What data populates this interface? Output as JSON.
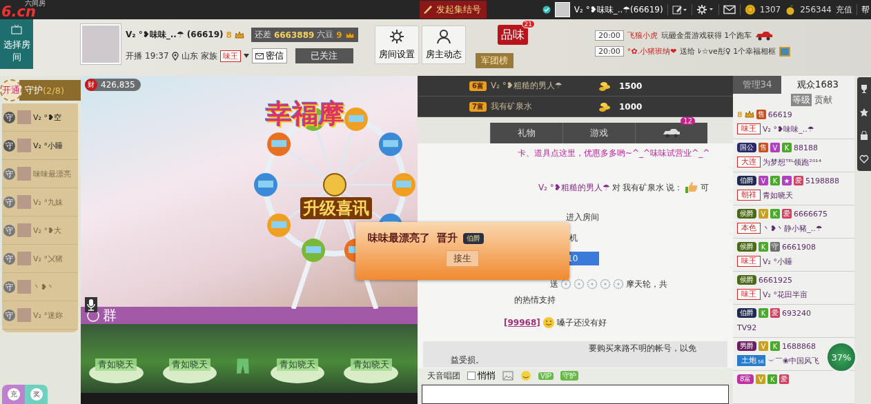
{
  "top_bar": {
    "logo_caption": "六间房",
    "logo": "6.cn",
    "rally_button": "发起集结号",
    "user_name": "V₂ °❥味味_..☂(66619)",
    "coins": "1307",
    "beans": "256344",
    "recharge": "充值",
    "help": "帮"
  },
  "room_button": "选择房间",
  "host": {
    "name": "V₂ °❥味味_..☂ (66619)",
    "level": "8",
    "gap_label": "还差",
    "gap_value": "6663889",
    "gap_unit": "六豆",
    "next_level": "9",
    "live_label": "开播",
    "live_time": "19:37",
    "location": "山东",
    "family_label": "家族",
    "family_tag": "味王",
    "message_button": "密信",
    "follow_button": "已关注"
  },
  "room_actions": [
    {
      "label": "房间设置"
    },
    {
      "label": "房主动态"
    }
  ],
  "taste_seal": {
    "label": "品味",
    "count": "21"
  },
  "legion_tab": "军团榜",
  "announcements": [
    {
      "time": "20:00",
      "user": "飞狼小虎",
      "text": "玩砸金蛋游戏获得 1个跑车",
      "kind": "car"
    },
    {
      "time": "20:00",
      "user": "°✿.小猪班纳❤",
      "text": "送给 ﾚ☆ve彤♀ 1个幸福相框",
      "kind": "frame"
    }
  ],
  "guard": {
    "open_button": "开通",
    "title": "守护",
    "count": "(2/8)",
    "members": [
      {
        "badge": "守",
        "name": "V₂ °❥空",
        "online": true
      },
      {
        "badge": "守",
        "name": "V₂ °小睡",
        "online": true
      },
      {
        "badge": "守",
        "name": "味味最漂亮",
        "online": false
      },
      {
        "badge": "守",
        "name": "V₂ °九妹",
        "online": false
      },
      {
        "badge": "守",
        "name": "V₂ °❥大",
        "online": false
      },
      {
        "badge": "守",
        "name": "V₂ °〤猪",
        "online": false
      },
      {
        "badge": "守",
        "name": "丶❥丶",
        "online": false
      },
      {
        "badge": "守",
        "name": "V₂ °迷妳",
        "online": false
      }
    ],
    "bottom_buttons": [
      "充",
      "奖"
    ]
  },
  "video": {
    "wealth_icon": "财",
    "wealth": "426,835",
    "group_label": "群",
    "stage_names": [
      "青如晓天",
      "青如晓天",
      "青如晓天",
      "青如晓天"
    ]
  },
  "animation": {
    "title": "幸福摩",
    "banner": "升级喜讯"
  },
  "popup": {
    "text": "味味最漂亮了  晋升",
    "rank_badge": "伯爵",
    "button": "接生"
  },
  "rank": [
    {
      "badge": "6富",
      "name": "V₂ °❥粗糙的男人☂",
      "amount": "1500"
    },
    {
      "badge": "7富",
      "name": "我有矿泉水",
      "amount": "1000"
    }
  ],
  "chat_tabs": [
    {
      "kind": "text",
      "label": "礼物",
      "selected": false
    },
    {
      "kind": "text",
      "label": "游戏",
      "selected": false
    },
    {
      "kind": "car",
      "count": "12",
      "selected": false
    }
  ],
  "messages": [
    {
      "kind": "notice",
      "text": "卡、道具点这里，优惠多多哟~^_^味味试营业^_^"
    },
    {
      "kind": "say",
      "from": "V₂ °❥粗糙的男人☂",
      "verb": "对",
      "to": "我有矿泉水",
      "said": "说：",
      "text": "可"
    },
    {
      "kind": "plain",
      "text": "进入房间"
    },
    {
      "kind": "plain",
      "text": "机"
    },
    {
      "kind": "box",
      "text": "10"
    },
    {
      "kind": "gift",
      "verb": "送",
      "icons": [
        {
          "kind": "wheel"
        },
        {
          "kind": "wheel"
        },
        {
          "kind": "wheel"
        },
        {
          "kind": "wheel"
        },
        {
          "kind": "wheel"
        }
      ],
      "text": "摩天轮，共"
    },
    {
      "kind": "plain",
      "text": "的热情支持"
    },
    {
      "kind": "chat",
      "user_id": "[99968]",
      "text": "嗓子还没有好"
    },
    {
      "kind": "system",
      "lines": [
        "要购买来路不明的帐号，以免",
        "益受损。"
      ]
    }
  ],
  "chat_toolbar": {
    "channel": "天音唱团",
    "whisper": {
      "label": "悄悄",
      "checked": false
    },
    "vip": "VIP",
    "guard": "守护"
  },
  "user_list": {
    "tabs": [
      {
        "label": "管理34",
        "selected": false
      },
      {
        "label": "观众1683",
        "selected": true
      }
    ],
    "sort": [
      {
        "label": "等级",
        "selected": true
      },
      {
        "label": "贡献",
        "selected": false
      }
    ],
    "users": [
      {
        "badges": [
          {
            "kind": "level",
            "text": "8"
          },
          {
            "kind": "square",
            "text": "售",
            "color": "#c8501e"
          }
        ],
        "id": "66619",
        "tag": {
          "kind": "outline",
          "text": "味王"
        },
        "name": "V₂ °❥味味_..☂"
      },
      {
        "badges": [
          {
            "kind": "title",
            "text": "国公",
            "color": "#2a2a6a"
          },
          {
            "kind": "square",
            "text": "售",
            "color": "#c8501e"
          },
          {
            "kind": "square",
            "text": "V",
            "color": "#b040c0"
          },
          {
            "kind": "square",
            "text": "K",
            "color": "#4aa82a"
          }
        ],
        "id": "88188",
        "tag": {
          "kind": "outline",
          "text": "大连"
        },
        "name": "为梦想ᵀᴱᴸ领跑²⁰¹⁴"
      },
      {
        "badges": [
          {
            "kind": "title",
            "text": "伯爵",
            "color": "#1e2a50"
          },
          {
            "kind": "square",
            "text": "V",
            "color": "#b040c0"
          },
          {
            "kind": "square",
            "text": "K",
            "color": "#4aa82a"
          },
          {
            "kind": "square",
            "text": "★",
            "color": "#b040c0"
          },
          {
            "kind": "square",
            "text": "爱",
            "color": "#d04060"
          }
        ],
        "id": "5198888",
        "tag": {
          "kind": "outline",
          "text": "朝祥"
        },
        "name": "青如晓天"
      },
      {
        "badges": [
          {
            "kind": "title",
            "text": "侯爵",
            "color": "#4a6a18"
          },
          {
            "kind": "square",
            "text": "V",
            "color": "#c8a020"
          },
          {
            "kind": "square",
            "text": "K",
            "color": "#4aa82a"
          },
          {
            "kind": "square",
            "text": "爱",
            "color": "#d04060"
          }
        ],
        "id": "6666675",
        "tag": {
          "kind": "outline",
          "text": "本色"
        },
        "name": "丶❥丶静小豬_..☂"
      },
      {
        "badges": [
          {
            "kind": "title",
            "text": "侯爵",
            "color": "#4a6a18"
          },
          {
            "kind": "square",
            "text": "K",
            "color": "#4aa82a"
          },
          {
            "kind": "square",
            "text": "守",
            "color": "#707070"
          }
        ],
        "id": "6661908",
        "tag": {
          "kind": "outline",
          "text": "味王"
        },
        "name": "V₂ °小睡"
      },
      {
        "badges": [
          {
            "kind": "title",
            "text": "侯爵",
            "color": "#4a6a18"
          }
        ],
        "id": "6661925",
        "tag": {
          "kind": "outline",
          "text": "味王"
        },
        "name": "V₂ °花田半亩"
      },
      {
        "badges": [
          {
            "kind": "title",
            "text": "伯爵",
            "color": "#1e2a50"
          },
          {
            "kind": "square",
            "text": "K",
            "color": "#4aa82a"
          },
          {
            "kind": "square",
            "text": "爱",
            "color": "#d04060"
          }
        ],
        "id": "693240",
        "name": "TV92"
      },
      {
        "badges": [
          {
            "kind": "title",
            "text": "男爵",
            "color": "#6a2060"
          },
          {
            "kind": "square",
            "text": "V",
            "color": "#c8a020"
          },
          {
            "kind": "square",
            "text": "K",
            "color": "#4aa82a"
          }
        ],
        "id": "1688868",
        "tag": {
          "kind": "filled",
          "text": "土炮",
          "sub": "56"
        },
        "name": "︶￣❀中国风飞"
      },
      {
        "badges": [
          {
            "kind": "title",
            "text": "8富",
            "color": "#c030a0"
          },
          {
            "kind": "square",
            "text": "V",
            "color": "#c8a020"
          },
          {
            "kind": "square",
            "text": "K",
            "color": "#4aa82a"
          },
          {
            "kind": "square",
            "text": "爱",
            "color": "#d04060"
          }
        ]
      }
    ]
  },
  "progress": {
    "label": "37%"
  }
}
